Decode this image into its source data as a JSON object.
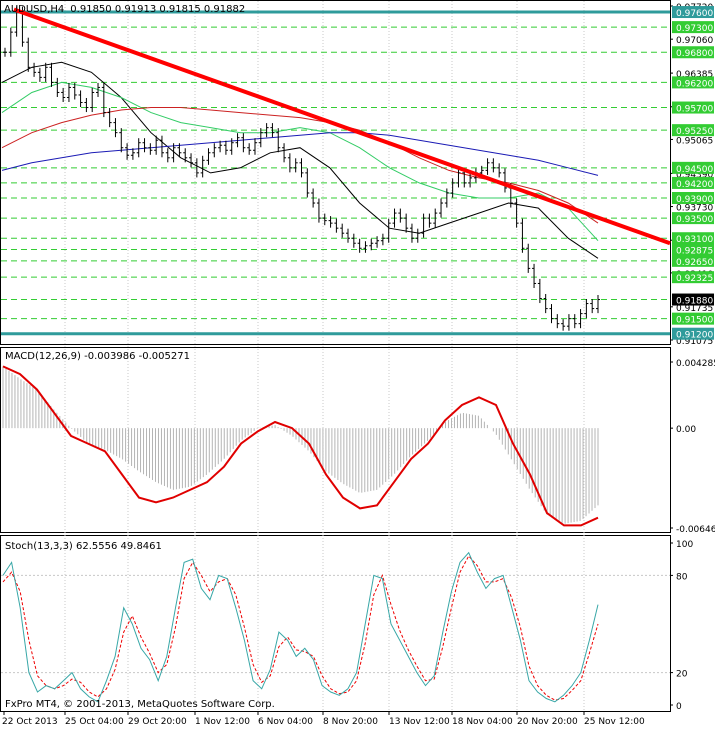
{
  "header": {
    "symbol": "AUDUSD,H4",
    "ohlc": "0.91850 0.91913 0.91815 0.91882"
  },
  "colors": {
    "background": "#ffffff",
    "border": "#000000",
    "grid": "#c8c8c8",
    "trendline": "#ff0000",
    "level_line": "#2f9b9b",
    "dashed_level": "#33cc33",
    "ma_black": "#000000",
    "ma_green": "#33cc66",
    "ma_red": "#cc2222",
    "ma_blue": "#1b1bb5",
    "macd_signal": "#e00000",
    "macd_hist": "#b4b4b4",
    "stoch_main": "#38a7a7",
    "stoch_signal": "#ee0000",
    "price_tag_bg": "#e6e6e6"
  },
  "price_axis_labels": [
    "0.97720",
    "0.97060",
    "0.96385",
    "0.95715",
    "0.95065",
    "0.94390",
    "0.93730",
    "0.93060",
    "0.92410",
    "0.91735",
    "0.91075"
  ],
  "level_tags": [
    "0.97600",
    "0.97300",
    "0.96800",
    "0.96200",
    "0.95700",
    "0.95250",
    "0.94500",
    "0.94200",
    "0.93900",
    "0.93500",
    "0.93100",
    "0.92875",
    "0.92650",
    "0.92325",
    "0.91880",
    "0.91500",
    "0.91200"
  ],
  "time_labels": [
    "22 Oct 2013",
    "25 Oct 04:00",
    "29 Oct 20:00",
    "1 Nov 12:00",
    "6 Nov 04:00",
    "8 Nov 20:00",
    "13 Nov 12:00",
    "18 Nov 04:00",
    "20 Nov 20:00",
    "25 Nov 12:00"
  ],
  "macd": {
    "label": "MACD(12,26,9) -0.003986 -0.005271",
    "axis_labels": [
      "0.004285",
      "0.00",
      "-0.006468"
    ]
  },
  "stoch": {
    "label": "Stoch(13,3,3) 62.5556 49.8461",
    "axis_labels": [
      "100",
      "80",
      "20",
      "0"
    ]
  },
  "copyright": "FxPro MT4, © 2001-2013, MetaQuotes Software Corp.",
  "chart_data": [
    {
      "type": "candlestick",
      "title": "AUDUSD,H4",
      "ylim": [
        0.91075,
        0.9772
      ],
      "horizontal_levels": [
        0.976,
        0.973,
        0.968,
        0.962,
        0.957,
        0.9525,
        0.945,
        0.942,
        0.939,
        0.935,
        0.931,
        0.92875,
        0.9265,
        0.92325,
        0.9188,
        0.915,
        0.912
      ],
      "highlighted_levels": [
        0.976,
        0.912
      ],
      "trendline": {
        "from": 0.9765,
        "to": 0.93
      },
      "close_series": [
        0.968,
        0.972,
        0.9762,
        0.97,
        0.965,
        0.964,
        0.963,
        0.965,
        0.962,
        0.96,
        0.959,
        0.961,
        0.9595,
        0.958,
        0.957,
        0.96,
        0.961,
        0.956,
        0.954,
        0.952,
        0.949,
        0.9475,
        0.948,
        0.95,
        0.949,
        0.9485,
        0.9505,
        0.948,
        0.947,
        0.949,
        0.948,
        0.947,
        0.946,
        0.944,
        0.9465,
        0.948,
        0.949,
        0.9495,
        0.9485,
        0.95,
        0.951,
        0.949,
        0.9485,
        0.95,
        0.952,
        0.953,
        0.952,
        0.949,
        0.947,
        0.945,
        0.946,
        0.944,
        0.94,
        0.938,
        0.935,
        0.9345,
        0.934,
        0.933,
        0.932,
        0.931,
        0.93,
        0.929,
        0.9295,
        0.93,
        0.9305,
        0.931,
        0.934,
        0.936,
        0.935,
        0.933,
        0.931,
        0.932,
        0.935,
        0.934,
        0.936,
        0.938,
        0.94,
        0.942,
        0.944,
        0.942,
        0.943,
        0.944,
        0.9445,
        0.946,
        0.945,
        0.944,
        0.941,
        0.938,
        0.934,
        0.929,
        0.925,
        0.922,
        0.919,
        0.917,
        0.915,
        0.914,
        0.9135,
        0.915,
        0.914,
        0.916,
        0.918,
        0.917,
        0.9188
      ],
      "moving_averages": [
        {
          "color": "black",
          "values": [
            0.962,
            0.965,
            0.966,
            0.964,
            0.959,
            0.952,
            0.947,
            0.944,
            0.945,
            0.948,
            0.949,
            0.945,
            0.938,
            0.933,
            0.932,
            0.934,
            0.936,
            0.938,
            0.937,
            0.931,
            0.927
          ]
        },
        {
          "color": "green",
          "values": [
            0.956,
            0.96,
            0.962,
            0.961,
            0.959,
            0.956,
            0.954,
            0.953,
            0.952,
            0.952,
            0.953,
            0.952,
            0.949,
            0.945,
            0.942,
            0.94,
            0.939,
            0.939,
            0.94,
            0.937,
            0.9305
          ]
        },
        {
          "color": "red",
          "values": [
            0.949,
            0.952,
            0.954,
            0.9555,
            0.9565,
            0.957,
            0.957,
            0.9565,
            0.956,
            0.9555,
            0.955,
            0.954,
            0.9525,
            0.95,
            0.947,
            0.9445,
            0.943,
            0.942,
            0.9405,
            0.938,
            0.934
          ]
        },
        {
          "color": "blue",
          "values": [
            0.9445,
            0.946,
            0.947,
            0.948,
            0.9485,
            0.949,
            0.9495,
            0.95,
            0.9505,
            0.951,
            0.9515,
            0.952,
            0.952,
            0.9515,
            0.9505,
            0.9495,
            0.9485,
            0.9475,
            0.9465,
            0.945,
            0.9435
          ]
        }
      ]
    },
    {
      "type": "line",
      "title": "MACD(12,26,9) -0.003986 -0.005271",
      "ylim": [
        -0.006468,
        0.004285
      ],
      "signal": [
        0.004,
        0.0035,
        0.0025,
        0.001,
        -0.0005,
        -0.001,
        -0.0015,
        -0.003,
        -0.0045,
        -0.0048,
        -0.0045,
        -0.004,
        -0.0035,
        -0.0025,
        -0.001,
        -0.0002,
        0.0004,
        0.0,
        -0.001,
        -0.003,
        -0.0045,
        -0.0052,
        -0.005,
        -0.0035,
        -0.002,
        -0.001,
        0.0005,
        0.0015,
        0.002,
        0.0015,
        -0.001,
        -0.003,
        -0.0055,
        -0.0063,
        -0.0063,
        -0.0058
      ],
      "histogram": [
        0.004,
        0.0032,
        0.0025,
        0.0012,
        0.0,
        -0.001,
        -0.0014,
        -0.002,
        -0.0028,
        -0.0035,
        -0.004,
        -0.0038,
        -0.003,
        -0.002,
        -0.0008,
        0.0,
        0.0002,
        -0.0005,
        -0.0015,
        -0.0028,
        -0.0036,
        -0.0042,
        -0.004,
        -0.003,
        -0.0018,
        -0.0008,
        0.0004,
        0.001,
        0.0008,
        -0.0004,
        -0.0022,
        -0.004,
        -0.0056,
        -0.0062,
        -0.006,
        -0.005
      ]
    },
    {
      "type": "line",
      "title": "Stoch(13,3,3) 62.5556 49.8461",
      "ylim": [
        0,
        100
      ],
      "main": [
        80,
        88,
        60,
        20,
        8,
        12,
        10,
        15,
        20,
        10,
        5,
        2,
        15,
        30,
        60,
        50,
        35,
        28,
        15,
        30,
        60,
        88,
        90,
        72,
        65,
        80,
        78,
        60,
        40,
        15,
        10,
        22,
        45,
        40,
        30,
        35,
        28,
        12,
        8,
        6,
        10,
        20,
        50,
        80,
        78,
        50,
        40,
        30,
        20,
        12,
        18,
        45,
        70,
        88,
        94,
        82,
        72,
        78,
        80,
        60,
        40,
        15,
        8,
        4,
        2,
        6,
        12,
        20,
        40,
        62
      ],
      "signal": [
        76,
        82,
        70,
        40,
        18,
        12,
        10,
        12,
        16,
        14,
        8,
        5,
        10,
        22,
        45,
        55,
        42,
        32,
        20,
        25,
        48,
        78,
        88,
        80,
        70,
        76,
        78,
        68,
        48,
        25,
        14,
        18,
        36,
        42,
        34,
        33,
        30,
        18,
        10,
        7,
        8,
        15,
        38,
        68,
        80,
        62,
        46,
        34,
        24,
        15,
        16,
        36,
        60,
        82,
        92,
        86,
        76,
        76,
        78,
        66,
        48,
        24,
        12,
        6,
        3,
        4,
        9,
        15,
        32,
        50
      ]
    }
  ]
}
